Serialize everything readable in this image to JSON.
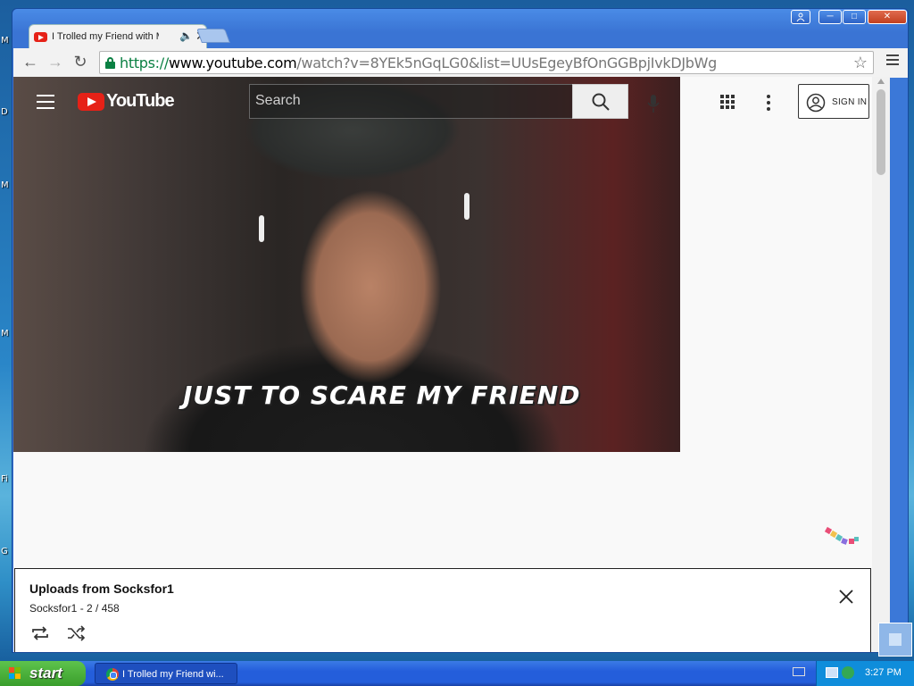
{
  "desktop": {
    "labels": [
      "M",
      "D",
      "M",
      "M",
      "Fi",
      "G"
    ]
  },
  "window": {
    "tab_title": "I Trolled my Friend with M",
    "url_scheme": "https://",
    "url_host": "www.youtube.com",
    "url_rest": "/watch?v=8YEk5nGqLG0&list=UUsEgeyBfOnGGBpjIvkDJbWg"
  },
  "youtube": {
    "logo_text": "YouTube",
    "search_placeholder": "Search",
    "signin_label": "SIGN IN",
    "video_caption": "JUST TO SCARE MY FRIEND"
  },
  "playlist": {
    "title": "Uploads from Socksfor1",
    "subtitle": "Socksfor1 - 2 / 458"
  },
  "taskbar": {
    "start_label": "start",
    "task_label": "I Trolled my Friend wi...",
    "clock": "3:27 PM"
  }
}
